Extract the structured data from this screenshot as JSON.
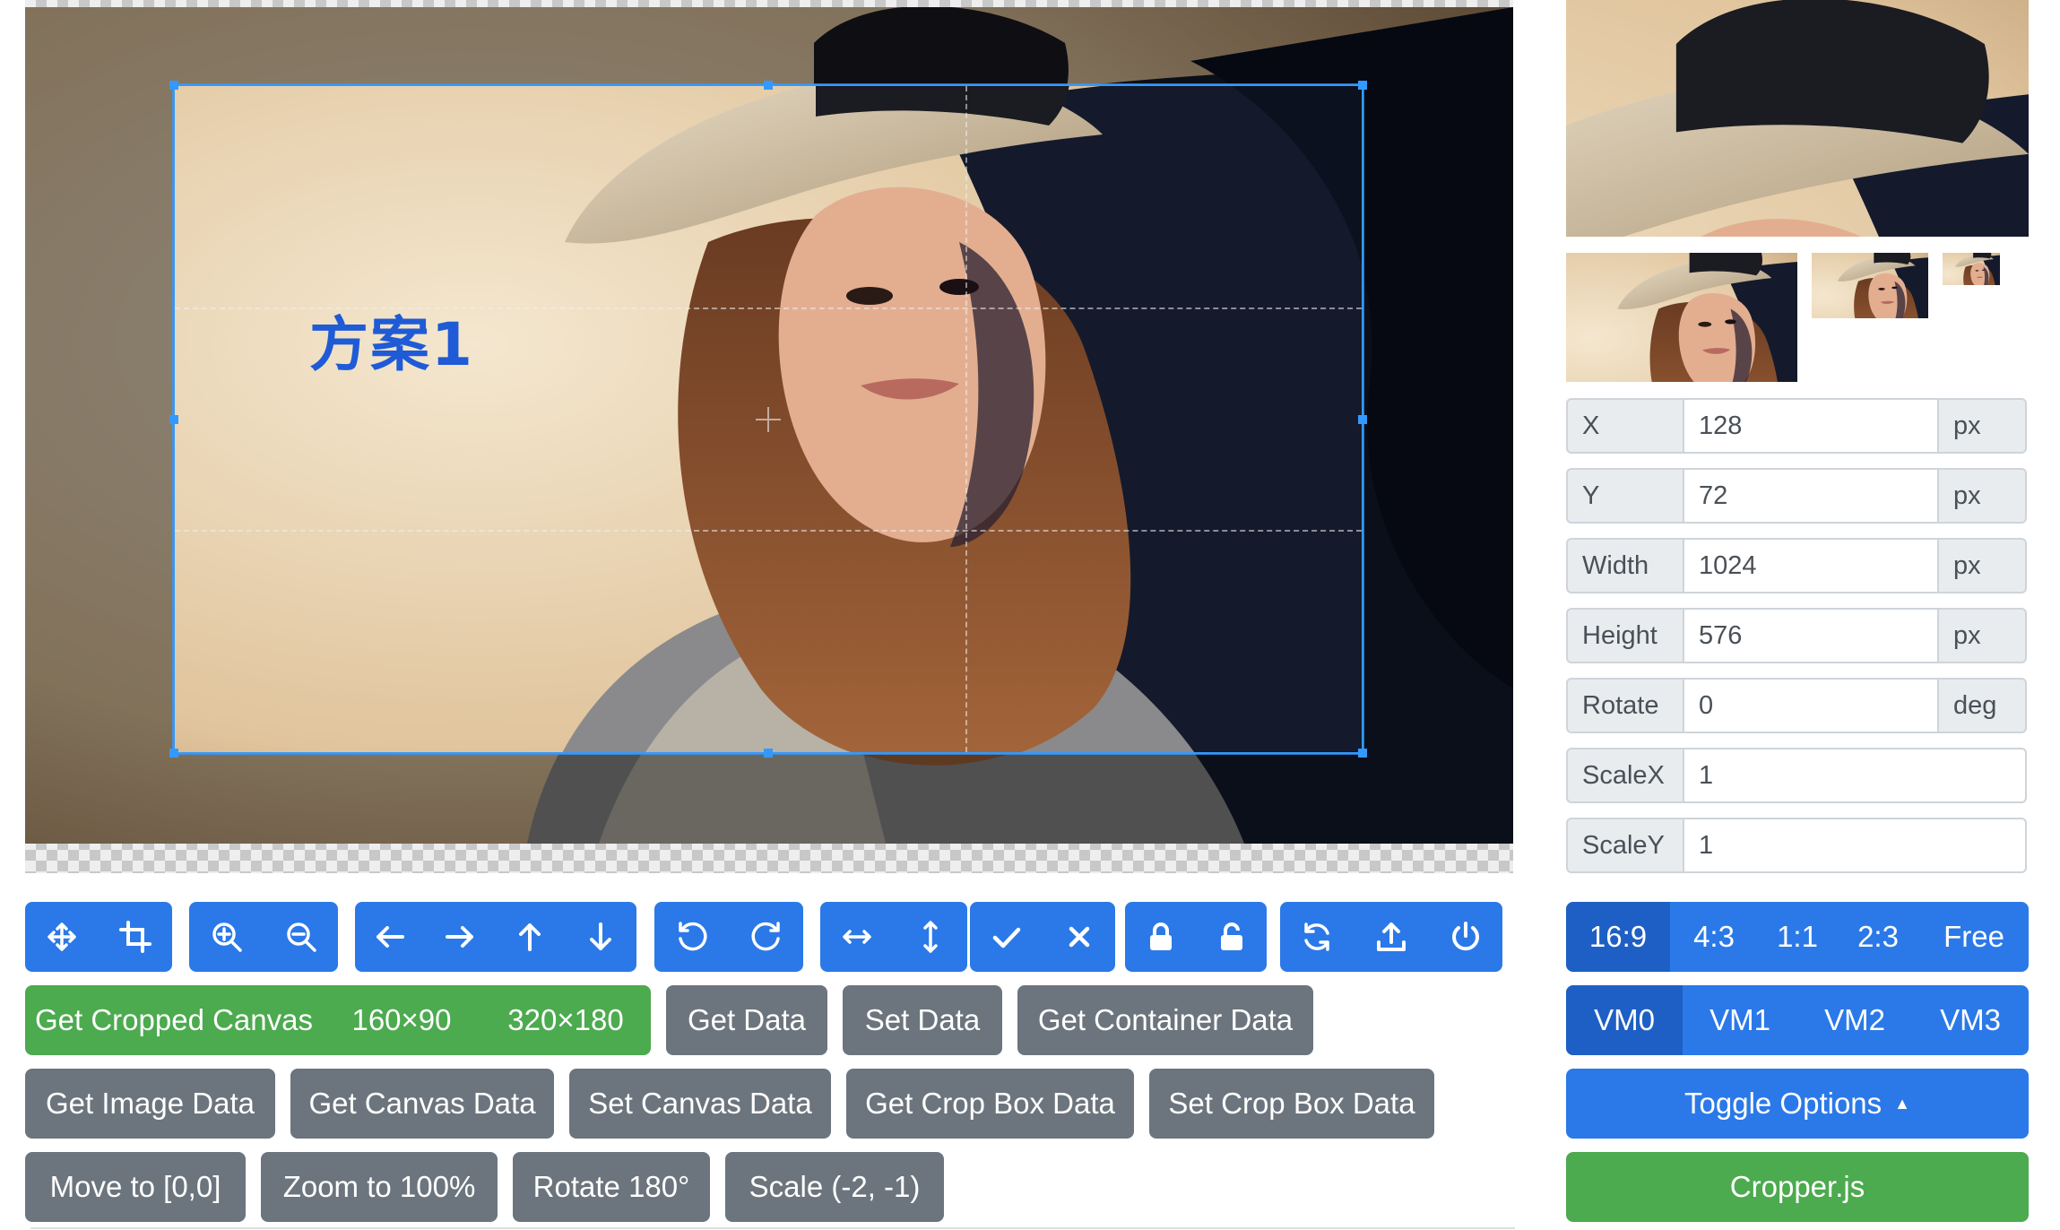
{
  "canvas": {
    "overlay_text": "方案1"
  },
  "toolbar": {
    "groups": [
      [
        "move-arrows-icon",
        "crop-icon"
      ],
      [
        "zoom-in-icon",
        "zoom-out-icon"
      ],
      [
        "arrow-left-icon",
        "arrow-right-icon",
        "arrow-up-icon",
        "arrow-down-icon"
      ],
      [
        "rotate-left-icon",
        "rotate-right-icon"
      ],
      [
        "flip-horizontal-icon",
        "flip-vertical-icon"
      ],
      [
        "check-icon",
        "close-icon"
      ],
      [
        "lock-icon",
        "unlock-icon"
      ],
      [
        "refresh-icon",
        "upload-icon",
        "power-icon"
      ]
    ]
  },
  "actions": {
    "get_cropped_canvas": "Get Cropped Canvas",
    "size_160": "160×90",
    "size_320": "320×180",
    "get_data": "Get Data",
    "set_data": "Set Data",
    "get_container_data": "Get Container Data",
    "get_image_data": "Get Image Data",
    "get_canvas_data": "Get Canvas Data",
    "set_canvas_data": "Set Canvas Data",
    "get_crop_box_data": "Get Crop Box Data",
    "set_crop_box_data": "Set Crop Box Data",
    "move_to": "Move to [0,0]",
    "zoom_to": "Zoom to 100%",
    "rotate_180": "Rotate 180°",
    "scale": "Scale (-2, -1)"
  },
  "data_fields": {
    "x": {
      "label": "X",
      "value": "128",
      "unit": "px"
    },
    "y": {
      "label": "Y",
      "value": "72",
      "unit": "px"
    },
    "width": {
      "label": "Width",
      "value": "1024",
      "unit": "px"
    },
    "height": {
      "label": "Height",
      "value": "576",
      "unit": "px"
    },
    "rotate": {
      "label": "Rotate",
      "value": "0",
      "unit": "deg"
    },
    "scalex": {
      "label": "ScaleX",
      "value": "1"
    },
    "scaley": {
      "label": "ScaleY",
      "value": "1"
    }
  },
  "aspect_ratios": [
    "16:9",
    "4:3",
    "1:1",
    "2:3",
    "Free"
  ],
  "view_modes": [
    "VM0",
    "VM1",
    "VM2",
    "VM3"
  ],
  "toggle_options": "Toggle Options",
  "toggle_caret": "▲",
  "brand_button": "Cropper.js",
  "colors": {
    "primary": "#2b79e8",
    "primary_active": "#1e5fc5",
    "success": "#4caa4f",
    "secondary": "#6c757d",
    "crop_border": "#3399ff"
  }
}
